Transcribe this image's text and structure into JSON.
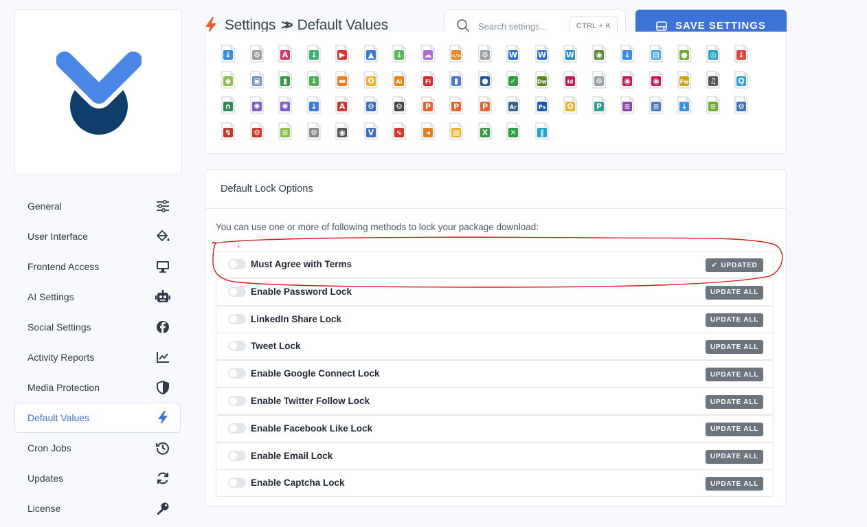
{
  "sidebar": {
    "items": [
      {
        "label": "General",
        "icon": "sliders-icon"
      },
      {
        "label": "User Interface",
        "icon": "paint-bucket-icon"
      },
      {
        "label": "Frontend Access",
        "icon": "monitor-icon"
      },
      {
        "label": "AI Settings",
        "icon": "robot-icon"
      },
      {
        "label": "Social Settings",
        "icon": "facebook-icon"
      },
      {
        "label": "Activity Reports",
        "icon": "chart-line-icon"
      },
      {
        "label": "Media Protection",
        "icon": "shield-icon"
      },
      {
        "label": "Default Values",
        "icon": "bolt-icon",
        "active": true
      },
      {
        "label": "Cron Jobs",
        "icon": "history-icon"
      },
      {
        "label": "Updates",
        "icon": "sync-icon"
      },
      {
        "label": "License",
        "icon": "key-icon"
      }
    ]
  },
  "header": {
    "title_part1": "Settings",
    "separator": ">>",
    "title_part2": "Default Values",
    "search_placeholder": "Search settings...",
    "shortcut": "CTRL + K",
    "save_label": "SAVE SETTINGS"
  },
  "colors": {
    "accent": "#3d73d8",
    "bolt": "#f05a28",
    "logo_blue": "#4a86e8",
    "logo_navy": "#0f3e6a",
    "annotation": "#d9181e"
  },
  "lock_options": {
    "title": "Default Lock Options",
    "description": "You can use one or more of following methods to lock your package download:",
    "rows": [
      {
        "label": "Must Agree with Terms",
        "button": "UPDATED",
        "updated": true
      },
      {
        "label": "Enable Password Lock",
        "button": "UPDATE ALL"
      },
      {
        "label": "LinkedIn Share Lock",
        "button": "UPDATE ALL"
      },
      {
        "label": "Tweet Lock",
        "button": "UPDATE ALL"
      },
      {
        "label": "Enable Google Connect Lock",
        "button": "UPDATE ALL"
      },
      {
        "label": "Enable Twitter Follow Lock",
        "button": "UPDATE ALL"
      },
      {
        "label": "Enable Facebook Like Lock",
        "button": "UPDATE ALL"
      },
      {
        "label": "Enable Email Lock",
        "button": "UPDATE ALL"
      },
      {
        "label": " Enable Captcha Lock",
        "button": "UPDATE ALL"
      }
    ]
  },
  "file_icons": [
    {
      "name": "download-file-icon",
      "color": "#3a8ee6",
      "glyph": "↓"
    },
    {
      "name": "settings-file-icon",
      "color": "#9aa0a6",
      "glyph": "⚙"
    },
    {
      "name": "text-file-icon",
      "color": "#d6336c",
      "glyph": "A"
    },
    {
      "name": "import-file-icon",
      "color": "#3cb371",
      "glyph": "↓"
    },
    {
      "name": "video-file-icon",
      "color": "#d9362b",
      "glyph": "▶"
    },
    {
      "name": "image-file-icon",
      "color": "#3a7bd5",
      "glyph": "▲"
    },
    {
      "name": "green-download-icon",
      "color": "#5cb85c",
      "glyph": "↓"
    },
    {
      "name": "cloud-file-icon",
      "color": "#b06ad8",
      "glyph": "☁"
    },
    {
      "name": "code-file-icon",
      "color": "#e68a2e",
      "glyph": "</>"
    },
    {
      "name": "gear-file-icon",
      "color": "#9aa0a6",
      "glyph": "⚙"
    },
    {
      "name": "word-file-icon",
      "color": "#2b6cd4",
      "glyph": "W"
    },
    {
      "name": "word-doc-icon",
      "color": "#2b6cd4",
      "glyph": "W"
    },
    {
      "name": "word-icon",
      "color": "#1f8bd8",
      "glyph": "W"
    },
    {
      "name": "database-icon",
      "color": "#5c8a3a",
      "glyph": "◉"
    },
    {
      "name": "down-arrow-file-icon",
      "color": "#3a8ee6",
      "glyph": "↓"
    },
    {
      "name": "archive-file-icon",
      "color": "#4aa3e0",
      "glyph": "▤"
    },
    {
      "name": "green-badge-icon",
      "color": "#6cae2b",
      "glyph": "●"
    },
    {
      "name": "teal-disc-icon",
      "color": "#1fa7c9",
      "glyph": "◎"
    },
    {
      "name": "red-download-icon",
      "color": "#e64545",
      "glyph": "↓"
    },
    {
      "name": "android-icon",
      "color": "#8bc34a",
      "glyph": "◆"
    },
    {
      "name": "installer-file-icon",
      "color": "#6a8fbf",
      "glyph": "▣"
    },
    {
      "name": "green-book-icon",
      "color": "#2e9e3e",
      "glyph": "▮"
    },
    {
      "name": "install-icon",
      "color": "#4caf50",
      "glyph": "↓"
    },
    {
      "name": "orange-folder-icon",
      "color": "#f07b1f",
      "glyph": "▬"
    },
    {
      "name": "yellow-ring-icon",
      "color": "#f2b233",
      "glyph": "O"
    },
    {
      "name": "illustrator-icon",
      "color": "#e8830c",
      "glyph": "Ai"
    },
    {
      "name": "flash-file-icon",
      "color": "#d1322a",
      "glyph": "Fl"
    },
    {
      "name": "blue-book-icon",
      "color": "#4a7bc2",
      "glyph": "▮"
    },
    {
      "name": "blue-photo-icon",
      "color": "#1c5aa8",
      "glyph": "●"
    },
    {
      "name": "check-file-icon",
      "color": "#2e9e3e",
      "glyph": "✓"
    },
    {
      "name": "dreamweaver-icon",
      "color": "#5a8a1e",
      "glyph": "Dw"
    },
    {
      "name": "indesign-icon",
      "color": "#c2185b",
      "glyph": "Id"
    },
    {
      "name": "gear-gray-icon",
      "color": "#9aa0a6",
      "glyph": "⚙"
    },
    {
      "name": "camera-file-icon",
      "color": "#c2185b",
      "glyph": "◉"
    },
    {
      "name": "camera-alt-icon",
      "color": "#c2185b",
      "glyph": "◉"
    },
    {
      "name": "fireworks-icon",
      "color": "#d4a017",
      "glyph": "Fw"
    },
    {
      "name": "music-file-icon",
      "color": "#555555",
      "glyph": "♫"
    },
    {
      "name": "quicktime-icon",
      "color": "#2fa4d8",
      "glyph": "Q"
    },
    {
      "name": "headphones-icon",
      "color": "#2e8b57",
      "glyph": "∩"
    },
    {
      "name": "lifebuoy-icon",
      "color": "#7b5ac8",
      "glyph": "✺"
    },
    {
      "name": "lifebuoy-alt-icon",
      "color": "#7b5ac8",
      "glyph": "✺"
    },
    {
      "name": "pdf-download-icon",
      "color": "#3a7bd5",
      "glyph": "↓"
    },
    {
      "name": "pdf-icon",
      "color": "#d1322a",
      "glyph": "A"
    },
    {
      "name": "blue-gears-icon",
      "color": "#3a6fc2",
      "glyph": "⚙"
    },
    {
      "name": "dark-gear-icon",
      "color": "#444444",
      "glyph": "⚙"
    },
    {
      "name": "powerpoint-icon",
      "color": "#e8622c",
      "glyph": "P"
    },
    {
      "name": "powerpoint-alt-icon",
      "color": "#e8622c",
      "glyph": "P"
    },
    {
      "name": "red-p-icon",
      "color": "#e8622c",
      "glyph": "P"
    },
    {
      "name": "audition-icon",
      "color": "#3a5f8a",
      "glyph": "Ar"
    },
    {
      "name": "photoshop-icon",
      "color": "#1c5aa8",
      "glyph": "Ps"
    },
    {
      "name": "outlook-icon",
      "color": "#e6b422",
      "glyph": "O"
    },
    {
      "name": "publisher-icon",
      "color": "#1fa38a",
      "glyph": "P"
    },
    {
      "name": "purple-list-icon",
      "color": "#8e44ad",
      "glyph": "≡"
    },
    {
      "name": "text-lines-icon",
      "color": "#4a7bc2",
      "glyph": "≡"
    },
    {
      "name": "contact-file-icon",
      "color": "#3a8ee6",
      "glyph": "↓"
    },
    {
      "name": "green-lines-icon",
      "color": "#6cae2b",
      "glyph": "≡"
    },
    {
      "name": "blue-gear-alt-icon",
      "color": "#3a6fc2",
      "glyph": "⚙"
    },
    {
      "name": "red-flame-icon",
      "color": "#c0392b",
      "glyph": "↯"
    },
    {
      "name": "red-gear-icon",
      "color": "#d9362b",
      "glyph": "⚙"
    },
    {
      "name": "green-text-icon",
      "color": "#8bc34a",
      "glyph": "≡"
    },
    {
      "name": "gray-gear-icon",
      "color": "#888888",
      "glyph": "⚙"
    },
    {
      "name": "eye-file-icon",
      "color": "#555555",
      "glyph": "◉"
    },
    {
      "name": "visio-icon",
      "color": "#3a6fc2",
      "glyph": "V"
    },
    {
      "name": "waveform-icon",
      "color": "#d9362b",
      "glyph": "∿"
    },
    {
      "name": "audio-file-icon",
      "color": "#e67e22",
      "glyph": "◂"
    },
    {
      "name": "yellow-bars-icon",
      "color": "#e6b422",
      "glyph": "▤"
    },
    {
      "name": "excel-icon",
      "color": "#2e9e3e",
      "glyph": "X"
    },
    {
      "name": "green-x-icon",
      "color": "#2e9e3e",
      "glyph": "✕"
    },
    {
      "name": "zipper-icon",
      "color": "#1fa7c9",
      "glyph": "‖"
    }
  ]
}
